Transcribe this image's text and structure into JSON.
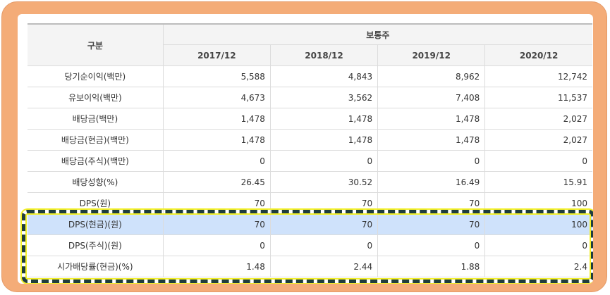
{
  "table": {
    "header": {
      "row_label": "구분",
      "group": "보통주",
      "years": [
        "2017/12",
        "2018/12",
        "2019/12",
        "2020/12"
      ]
    },
    "rows": [
      {
        "label": "당기순이익(백만)",
        "values": [
          "5,588",
          "4,843",
          "8,962",
          "12,742"
        ]
      },
      {
        "label": "유보이익(백만)",
        "values": [
          "4,673",
          "3,562",
          "7,408",
          "11,537"
        ]
      },
      {
        "label": "배당금(백만)",
        "values": [
          "1,478",
          "1,478",
          "1,478",
          "2,027"
        ]
      },
      {
        "label": "배당금(현금)(백만)",
        "values": [
          "1,478",
          "1,478",
          "1,478",
          "2,027"
        ]
      },
      {
        "label": "배당금(주식)(백만)",
        "values": [
          "0",
          "0",
          "0",
          "0"
        ]
      },
      {
        "label": "배당성향(%)",
        "values": [
          "26.45",
          "30.52",
          "16.49",
          "15.91"
        ]
      },
      {
        "label": "DPS(원)",
        "values": [
          "70",
          "70",
          "70",
          "100"
        ]
      },
      {
        "label": "DPS(현금)(원)",
        "values": [
          "70",
          "70",
          "70",
          "100"
        ]
      },
      {
        "label": "DPS(주식)(원)",
        "values": [
          "0",
          "0",
          "0",
          "0"
        ]
      },
      {
        "label": "시가배당률(현금)(%)",
        "values": [
          "1.48",
          "2.44",
          "1.88",
          "2.4"
        ]
      }
    ],
    "highlighted_row_index": 7,
    "highlight_color": "#cfe2fb"
  },
  "colors": {
    "frame": "#f4ac78",
    "dash_border": "#1f3d3d",
    "dash_glow": "#f2ef2a"
  }
}
